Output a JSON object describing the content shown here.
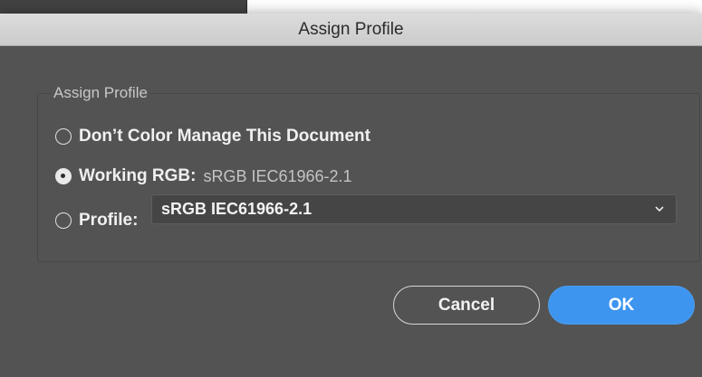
{
  "dialog": {
    "title": "Assign Profile",
    "group_label": "Assign Profile",
    "options": [
      {
        "label": "Don’t Color Manage This Document",
        "selected": false
      },
      {
        "label": "Working RGB:",
        "value": "sRGB IEC61966-2.1",
        "selected": true
      },
      {
        "label": "Profile:",
        "selected": false
      }
    ],
    "profile_select": {
      "selected": "sRGB IEC61966-2.1"
    },
    "buttons": {
      "cancel": "Cancel",
      "ok": "OK"
    }
  },
  "colors": {
    "dialog_bg": "#535353",
    "titlebar_bg": "#d4d4d4",
    "accent_ok": "#3d95ef",
    "select_bg": "#454545"
  },
  "icons": {
    "dropdown": "chevron-down-icon",
    "radio_off": "radio-unchecked-icon",
    "radio_on": "radio-checked-icon"
  }
}
